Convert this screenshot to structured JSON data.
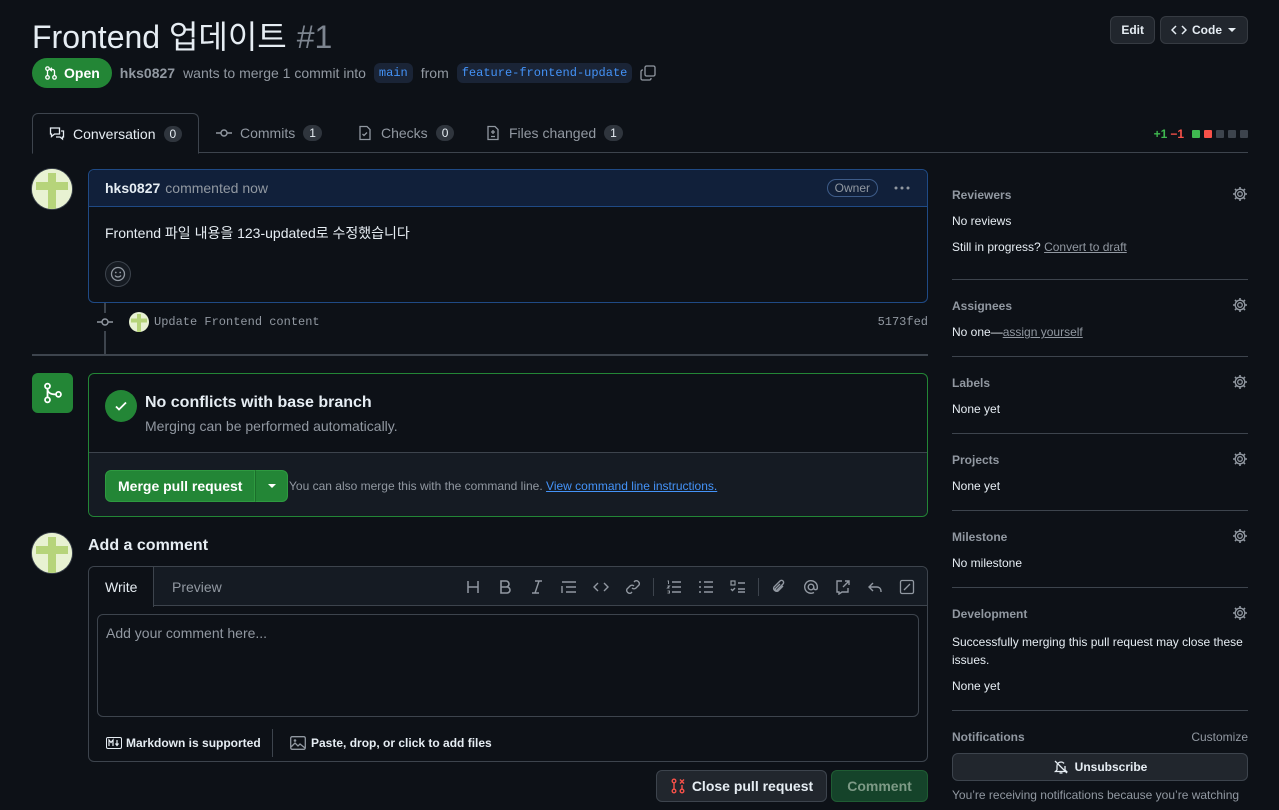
{
  "header": {
    "title": "Frontend 업데이트",
    "number": "#1",
    "edit_label": "Edit",
    "code_label": "Code"
  },
  "meta": {
    "state": "Open",
    "author": "hks0827",
    "text_before": "wants to merge 1 commit into",
    "base_branch": "main",
    "text_from": "from",
    "head_branch": "feature-frontend-update"
  },
  "tabs": [
    {
      "label": "Conversation",
      "count": "0"
    },
    {
      "label": "Commits",
      "count": "1"
    },
    {
      "label": "Checks",
      "count": "0"
    },
    {
      "label": "Files changed",
      "count": "1"
    }
  ],
  "diffstat": {
    "additions": "+1",
    "deletions": "−1"
  },
  "comment": {
    "author": "hks0827",
    "action": "commented now",
    "badge": "Owner",
    "body": "Frontend 파일 내용을 123-updated로 수정했습니다"
  },
  "commit": {
    "message": "Update Frontend content",
    "sha": "5173fed"
  },
  "merge": {
    "title": "No conflicts with base branch",
    "subtitle": "Merging can be performed automatically.",
    "button": "Merge pull request",
    "hint": "You can also merge this with the command line.",
    "hint_link": "View command line instructions."
  },
  "add_comment": {
    "title": "Add a comment",
    "tab_write": "Write",
    "tab_preview": "Preview",
    "placeholder": "Add your comment here...",
    "markdown": "Markdown is supported",
    "attach": "Paste, drop, or click to add files",
    "close_button": "Close pull request",
    "comment_button": "Comment"
  },
  "sidebar": {
    "reviewers": {
      "title": "Reviewers",
      "value": "No reviews",
      "progress_text": "Still in progress?",
      "progress_link": "Convert to draft"
    },
    "assignees": {
      "title": "Assignees",
      "value": "No one—",
      "link": "assign yourself"
    },
    "labels": {
      "title": "Labels",
      "value": "None yet"
    },
    "projects": {
      "title": "Projects",
      "value": "None yet"
    },
    "milestone": {
      "title": "Milestone",
      "value": "No milestone"
    },
    "development": {
      "title": "Development",
      "desc": "Successfully merging this pull request may close these issues.",
      "value": "None yet"
    },
    "notifications": {
      "title": "Notifications",
      "customize": "Customize",
      "button": "Unsubscribe",
      "desc": "You’re receiving notifications because you’re watching"
    }
  },
  "colors": {
    "open": "#238636",
    "link": "#4493f8",
    "add": "#3fb950",
    "del": "#f85149",
    "background": "#0d1117"
  }
}
